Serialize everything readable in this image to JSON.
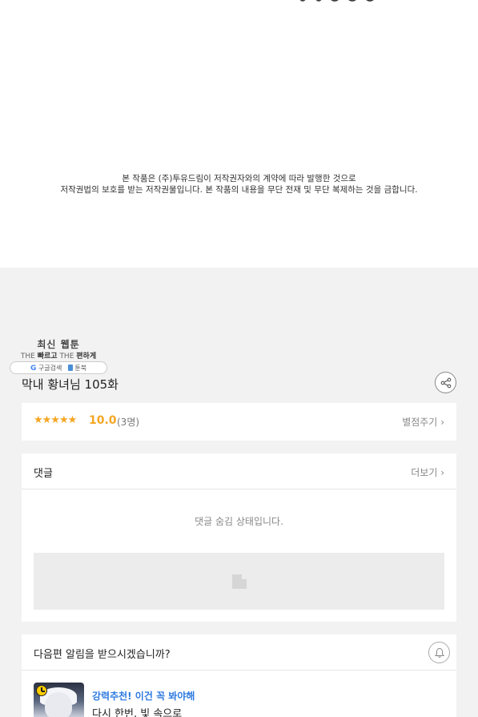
{
  "copyright": {
    "line1": "본 작품은 (주)투유드림이 저작권자와의 계약에 따라 발행한 것으로",
    "line2": "저작권법의 보호를 받는 저작권물입니다. 본 작품의 내용을 무단 전재 및 무단 복제하는 것을 금합니다."
  },
  "watermark": {
    "title": "최신 웹툰",
    "sub_the1": "THE",
    "sub_fast": "빠르고",
    "sub_the2": "THE",
    "sub_easy": "편하게",
    "google_label": "구글검색",
    "tonbook_label": "툰북"
  },
  "episode": {
    "title": "막내 황녀님 105화"
  },
  "rating": {
    "stars": "★★★★★",
    "score": "10.0",
    "count": "(3명)",
    "rate_link": "별점주기"
  },
  "comments": {
    "label": "댓글",
    "more_link": "더보기",
    "hidden_message": "댓글 숨김 상태입니다."
  },
  "notify": {
    "question": "다음편 알림을 받으시겠습니까?"
  },
  "recommendation": {
    "label": "강력추천! 이건 꼭 봐야해",
    "title": "다시 한번, 빛 속으로"
  },
  "colors": {
    "accent_star": "#f5a623",
    "accent_link": "#2f7be0",
    "background": "#f2f2f2"
  },
  "icons": [
    "share-icon",
    "chevron-right-icon",
    "bell-icon",
    "clock-icon",
    "image-placeholder-icon",
    "google-icon",
    "book-icon"
  ]
}
